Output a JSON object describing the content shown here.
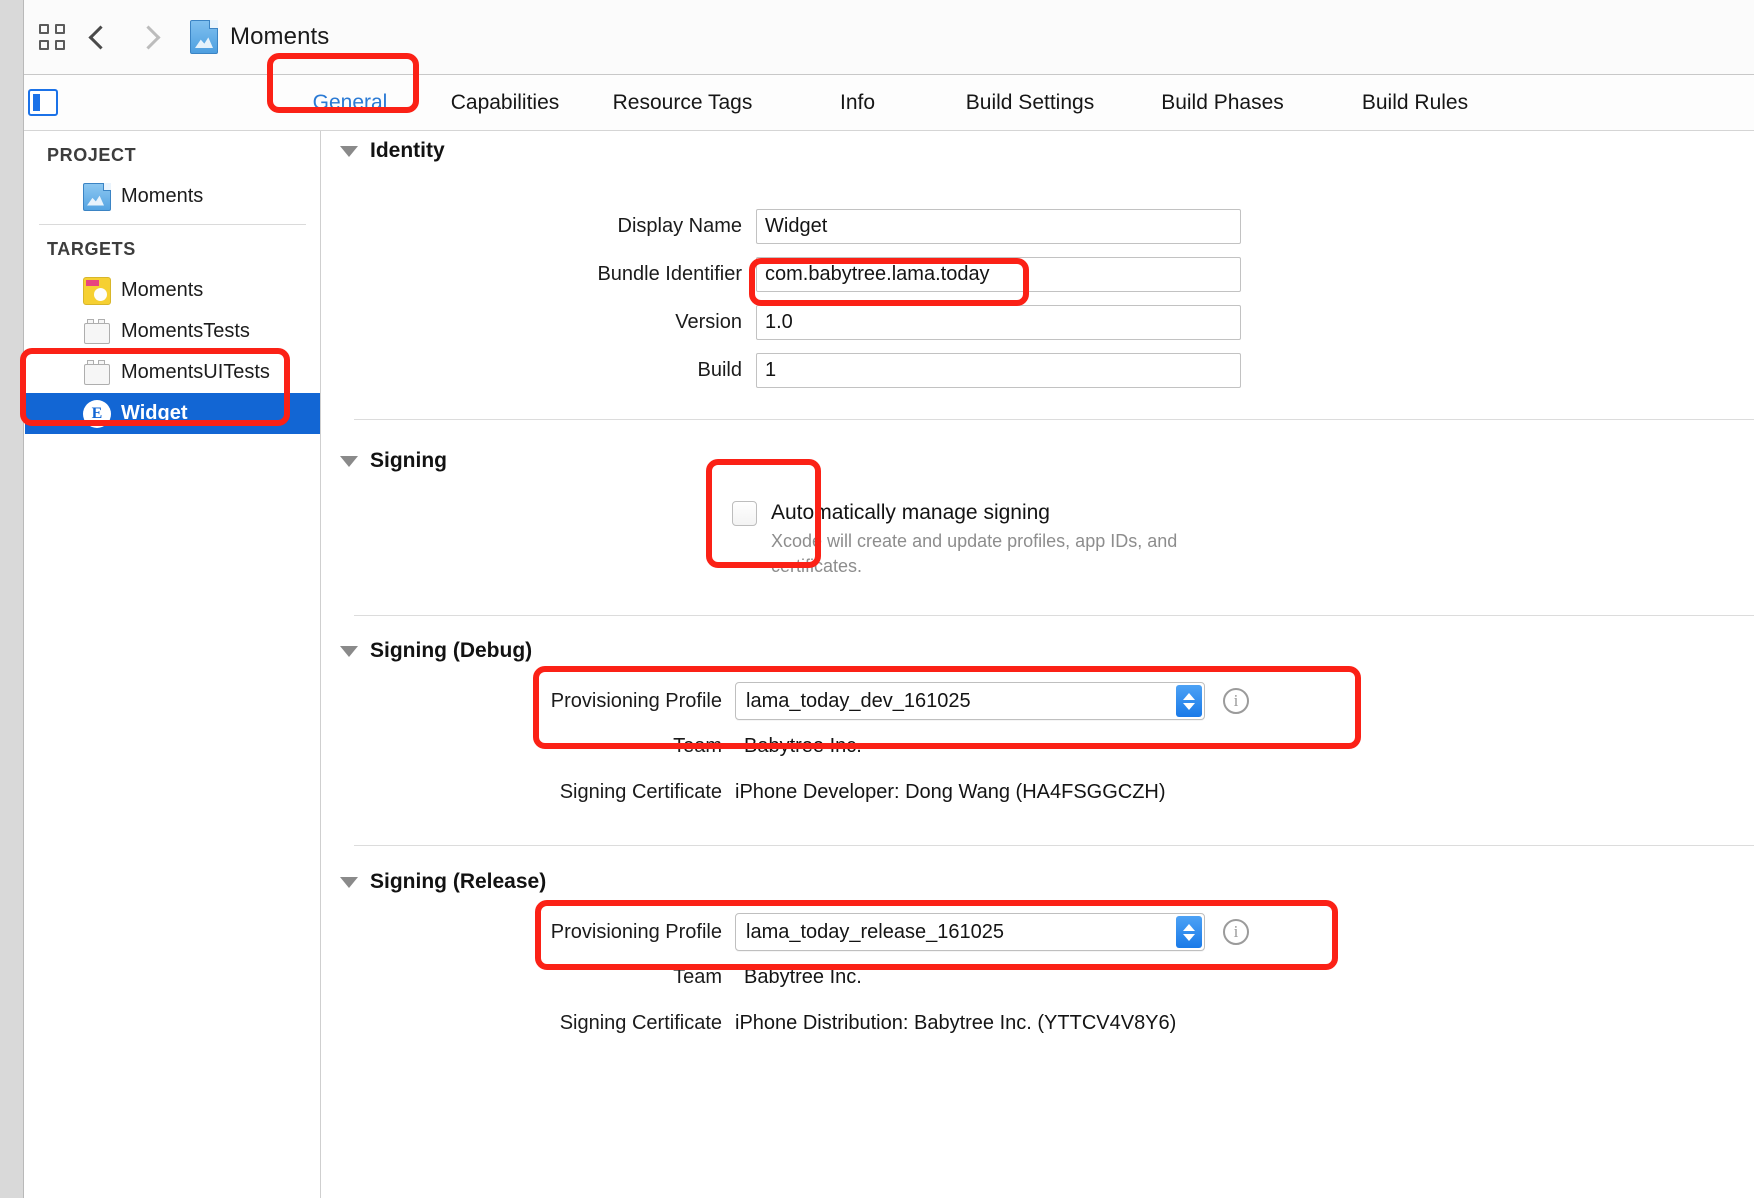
{
  "toolbar": {
    "grid_icon": "grid-icon",
    "back_icon": "chevron-left-icon",
    "forward_icon": "chevron-right-icon",
    "project_icon": "xcode-project-icon",
    "title": "Moments"
  },
  "tabbar": {
    "panel_toggle_icon": "navigator-toggle-icon",
    "tabs": [
      {
        "label": "General",
        "active": true
      },
      {
        "label": "Capabilities",
        "active": false
      },
      {
        "label": "Resource Tags",
        "active": false
      },
      {
        "label": "Info",
        "active": false
      },
      {
        "label": "Build Settings",
        "active": false
      },
      {
        "label": "Build Phases",
        "active": false
      },
      {
        "label": "Build Rules",
        "active": false
      }
    ]
  },
  "sidebar": {
    "project_header": "PROJECT",
    "project_items": [
      {
        "label": "Moments",
        "icon": "xcode-project-icon"
      }
    ],
    "targets_header": "TARGETS",
    "target_items": [
      {
        "label": "Moments",
        "icon": "app-target-icon",
        "selected": false
      },
      {
        "label": "MomentsTests",
        "icon": "test-bundle-icon",
        "selected": false
      },
      {
        "label": "MomentsUITests",
        "icon": "test-bundle-icon",
        "selected": false
      },
      {
        "label": "Widget",
        "icon": "extension-target-icon",
        "selected": true
      }
    ]
  },
  "identity": {
    "title": "Identity",
    "fields": [
      {
        "label": "Display Name",
        "value": "Widget"
      },
      {
        "label": "Bundle Identifier",
        "value": "com.babytree.lama.today"
      },
      {
        "label": "Version",
        "value": "1.0"
      },
      {
        "label": "Build",
        "value": "1"
      }
    ]
  },
  "signing": {
    "title": "Signing",
    "checkbox_label": "Automatically manage signing",
    "checkbox_checked": false,
    "description": "Xcode will create and update profiles, app IDs, and certificates."
  },
  "signing_debug": {
    "title": "Signing (Debug)",
    "provisioning_label": "Provisioning Profile",
    "provisioning_value": "lama_today_dev_161025",
    "info_icon": "info-icon",
    "team_label": "Team",
    "team_value": "Babytree Inc.",
    "certificate_label": "Signing Certificate",
    "certificate_value": "iPhone Developer: Dong Wang (HA4FSGGCZH)"
  },
  "signing_release": {
    "title": "Signing (Release)",
    "provisioning_label": "Provisioning Profile",
    "provisioning_value": "lama_today_release_161025",
    "info_icon": "info-icon",
    "team_label": "Team",
    "team_value": "Babytree Inc.",
    "certificate_label": "Signing Certificate",
    "certificate_value": "iPhone Distribution: Babytree Inc. (YTTCV4V8Y6)"
  },
  "annotations": {
    "accent_color": "#fb2116",
    "selection_color": "#1266d4",
    "link_color": "#2a7ad4"
  }
}
